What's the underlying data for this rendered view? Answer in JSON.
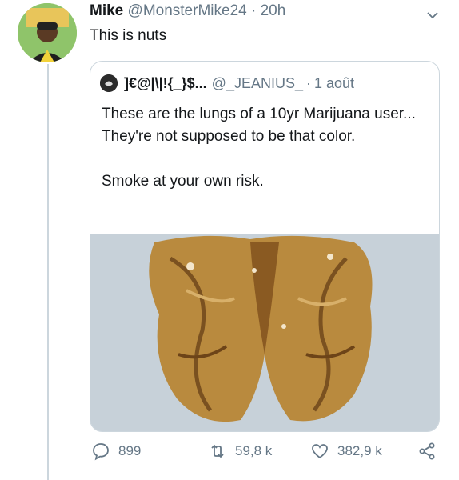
{
  "tweet": {
    "name": "Mike",
    "handle": "@MonsterMike24",
    "separator": "·",
    "time": "20h",
    "text": "This is nuts"
  },
  "quote": {
    "name": "]€@|\\|!{_}$...",
    "handle": "@_JEANIUS_",
    "separator": "·",
    "date": "1 août",
    "text_line1": "These are the lungs of a 10yr Marijuana user... They're not supposed to be that color.",
    "text_line2": "Smoke at your own risk."
  },
  "actions": {
    "replies": "899",
    "retweets": "59,8 k",
    "likes": "382,9 k"
  },
  "colors": {
    "text": "#14171a",
    "secondary": "#657786",
    "border": "#ccd6dd",
    "image_background": "#c7d1d9",
    "walnut": "#b98a3e"
  },
  "icons": [
    "chevron-down-icon",
    "reply-icon",
    "retweet-icon",
    "like-icon",
    "share-icon"
  ]
}
